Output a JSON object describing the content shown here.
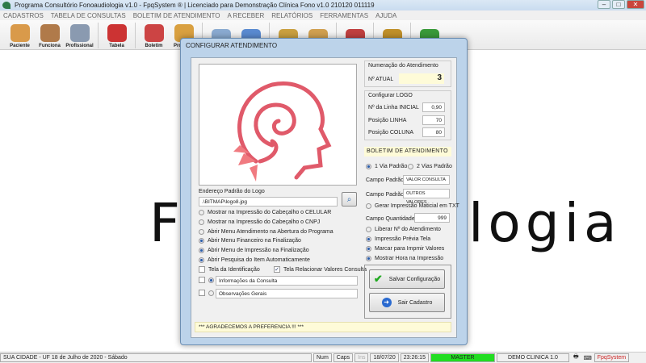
{
  "window": {
    "title": "Programa Consultório Fonoaudiologia v1.0 - FpqSystem ® | Licenciado para  Demonstração Clínica Fono v1.0 210120 011119"
  },
  "menu": [
    "CADASTROS",
    "TABELA DE CONSULTAS",
    "BOLETIM DE ATENDIMENTO",
    "A RECEBER",
    "RELATÓRIOS",
    "FERRAMENTAS",
    "AJUDA"
  ],
  "toolbar": [
    {
      "label": "Paciente",
      "color": "#d99a4a"
    },
    {
      "label": "Funciona",
      "color": "#b07a4a"
    },
    {
      "label": "Profissional",
      "color": "#8a9ab0"
    },
    {
      "label": "Tabela",
      "color": "#c33"
    },
    {
      "label": "Boletim",
      "color": "#c44"
    },
    {
      "label": "Procurar",
      "color": "#d9a040"
    },
    {
      "label": "",
      "color": "#8aaad0"
    },
    {
      "label": "",
      "color": "#5a8ad0"
    },
    {
      "label": "",
      "color": "#c9a040"
    },
    {
      "label": "",
      "color": "#d0a050"
    },
    {
      "label": "",
      "color": "#c04040"
    },
    {
      "label": "",
      "color": "#c0902a"
    },
    {
      "label": "",
      "color": "#3a9a3a"
    }
  ],
  "background_logo_text": "Fonoaudiologia",
  "dialog": {
    "title": "CONFIGURAR ATENDIMENTO",
    "logo_address_label": "Endereço Padrão do Logo",
    "logo_address_value": ".\\BITMAP\\logo8.jpg",
    "options": [
      {
        "label": "Mostrar na Impressão do Cabeçalho o CELULAR",
        "checked": false
      },
      {
        "label": "Mostrar na Impressão do Cabeçalho o CNPJ",
        "checked": false
      },
      {
        "label": "Abrir Menu Atendimento na Abertura do Programa",
        "checked": false
      },
      {
        "label": "Abrir Menu Financeiro na Finalização",
        "checked": true
      },
      {
        "label": "Abrir Menu de Impressão na Finalização",
        "checked": true
      },
      {
        "label": "Abrir Pesquisa do Item Automaticamente",
        "checked": true
      }
    ],
    "tela_identificacao": "Tela da Identificação",
    "tela_relacionar": "Tela Relacionar Valores Consulta",
    "info_consulta": "Informações da Consulta",
    "observacoes": "Observações Gerais",
    "footer_message": "*** AGRADECEMOS A PREFERENCIA !!! ***",
    "numeracao": {
      "title": "Numeração do Atendimento",
      "label": "Nº ATUAL",
      "value": "3"
    },
    "logo_config": {
      "title": "Configurar LOGO",
      "linha_inicial_label": "Nº da Linha INICIAL",
      "linha_inicial": "0,90",
      "linha_label": "Posição LINHA",
      "linha": "70",
      "coluna_label": "Posição COLUNA",
      "coluna": "80"
    },
    "boletim": {
      "title": "BOLETIM DE ATENDIMENTO",
      "via1": "1 Via Padrão",
      "via2": "2 Vias Padrão",
      "campo_label": "Campo Padrão",
      "campo1": "VALOR CONSULTA",
      "campo2": "OUTROS VALORES",
      "gerar_txt": "Gerar Impressão Maticial em TXT",
      "qtd_label": "Campo Quantidade",
      "qtd": "999",
      "right_options": [
        {
          "label": "Liberar Nº do Atendimento",
          "checked": false
        },
        {
          "label": "Impressão Prévia Tela",
          "checked": true
        },
        {
          "label": "Marcar para Impmir Valores",
          "checked": true
        },
        {
          "label": "Mostrar Hora na Impressão",
          "checked": true
        }
      ]
    },
    "save_label": "Salvar Configuração",
    "exit_label": "Sair Cadastro"
  },
  "status": {
    "city": "SUA CIDADE - UF 18 de Julho de 2020 - Sábado",
    "num": "Num",
    "caps": "Caps",
    "ins": "Ins",
    "date": "18/07/20",
    "time": "23:26:15",
    "user": "MASTER",
    "user_color": "#22dd22",
    "company": "DEMO CLINICA 1.0",
    "brand": "FpqSystem"
  }
}
